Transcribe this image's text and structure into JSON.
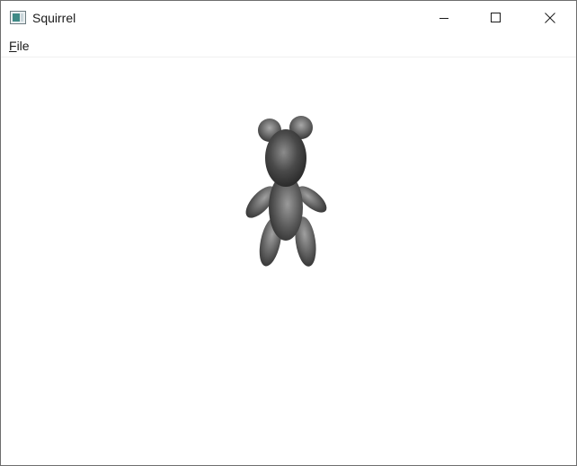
{
  "window": {
    "title": "Squirrel",
    "app_icon": "window-app-icon",
    "controls": {
      "minimize_icon": "minimize-icon",
      "maximize_icon": "maximize-icon",
      "close_icon": "close-icon"
    }
  },
  "menubar": {
    "items": [
      {
        "label": "File",
        "mnemonic": "F",
        "rest": "ile"
      }
    ]
  },
  "viewport": {
    "background": "#ffffff",
    "model": "teddy-bear-3d-model",
    "model_color": "#5a5a5a"
  }
}
